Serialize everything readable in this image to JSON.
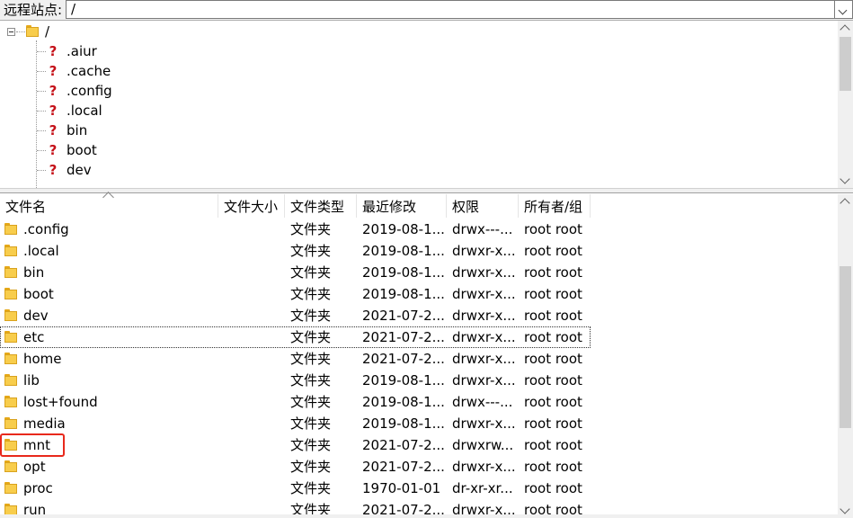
{
  "path_bar": {
    "label": "远程站点:",
    "value": "/"
  },
  "tree": {
    "root": "/",
    "children": [
      ".aiur",
      ".cache",
      ".config",
      ".local",
      "bin",
      "boot",
      "dev"
    ]
  },
  "columns": [
    "文件名",
    "文件大小",
    "文件类型",
    "最近修改",
    "权限",
    "所有者/组"
  ],
  "rows": [
    {
      "name": ".config",
      "size": "",
      "type": "文件夹",
      "modified": "2019-08-1...",
      "perm": "drwx---...",
      "owner": "root root"
    },
    {
      "name": ".local",
      "size": "",
      "type": "文件夹",
      "modified": "2019-08-1...",
      "perm": "drwxr-x...",
      "owner": "root root"
    },
    {
      "name": "bin",
      "size": "",
      "type": "文件夹",
      "modified": "2019-08-1...",
      "perm": "drwxr-x...",
      "owner": "root root"
    },
    {
      "name": "boot",
      "size": "",
      "type": "文件夹",
      "modified": "2019-08-1...",
      "perm": "drwxr-x...",
      "owner": "root root"
    },
    {
      "name": "dev",
      "size": "",
      "type": "文件夹",
      "modified": "2021-07-2...",
      "perm": "drwxr-x...",
      "owner": "root root"
    },
    {
      "name": "etc",
      "size": "",
      "type": "文件夹",
      "modified": "2021-07-2...",
      "perm": "drwxr-x...",
      "owner": "root root"
    },
    {
      "name": "home",
      "size": "",
      "type": "文件夹",
      "modified": "2021-07-2...",
      "perm": "drwxr-x...",
      "owner": "root root"
    },
    {
      "name": "lib",
      "size": "",
      "type": "文件夹",
      "modified": "2019-08-1...",
      "perm": "drwxr-x...",
      "owner": "root root"
    },
    {
      "name": "lost+found",
      "size": "",
      "type": "文件夹",
      "modified": "2019-08-1...",
      "perm": "drwx---...",
      "owner": "root root"
    },
    {
      "name": "media",
      "size": "",
      "type": "文件夹",
      "modified": "2019-08-1...",
      "perm": "drwxr-x...",
      "owner": "root root"
    },
    {
      "name": "mnt",
      "size": "",
      "type": "文件夹",
      "modified": "2021-07-2...",
      "perm": "drwxrw...",
      "owner": "root root"
    },
    {
      "name": "opt",
      "size": "",
      "type": "文件夹",
      "modified": "2021-07-2...",
      "perm": "drwxr-x...",
      "owner": "root root"
    },
    {
      "name": "proc",
      "size": "",
      "type": "文件夹",
      "modified": "1970-01-01",
      "perm": "dr-xr-xr...",
      "owner": "root root"
    },
    {
      "name": "run",
      "size": "",
      "type": "文件夹",
      "modified": "2021-07-2...",
      "perm": "drwxr-x...",
      "owner": "root root"
    }
  ],
  "focused_row": "etc",
  "highlighted_row": "mnt"
}
